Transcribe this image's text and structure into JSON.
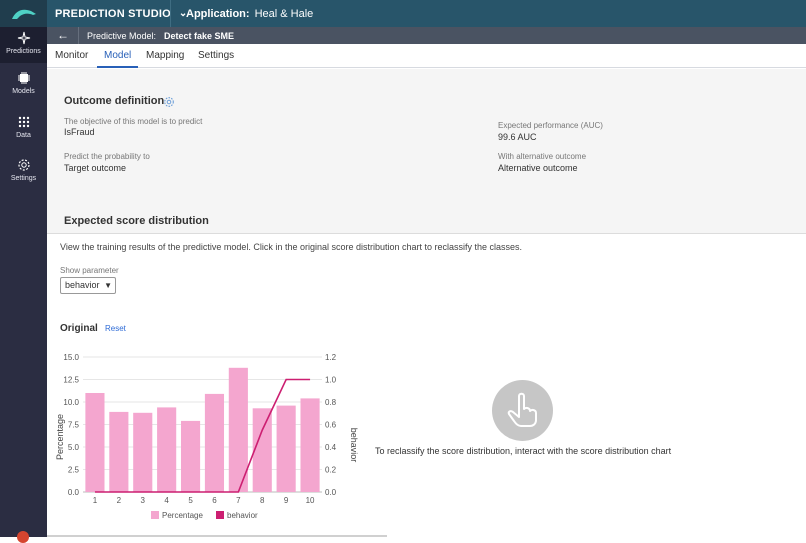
{
  "topbar": {
    "studio_label": "PREDICTION STUDIO",
    "app_label": "Application:",
    "app_name": "Heal & Hale"
  },
  "sidebar": {
    "items": [
      {
        "label": "Predictions"
      },
      {
        "label": "Models"
      },
      {
        "label": "Data"
      },
      {
        "label": "Settings"
      }
    ]
  },
  "subheader": {
    "prefix": "Predictive Model:",
    "model_name": "Detect fake SME"
  },
  "tabs": [
    {
      "label": "Monitor"
    },
    {
      "label": "Model",
      "active": true
    },
    {
      "label": "Mapping"
    },
    {
      "label": "Settings"
    }
  ],
  "outcome": {
    "title": "Outcome definition",
    "objective_label": "The objective of this model is to predict",
    "objective_value": "IsFraud",
    "probability_label": "Predict the probability to",
    "probability_value": "Target outcome",
    "performance_label": "Expected performance (AUC)",
    "performance_value": "99.6 AUC",
    "alternative_label": "With alternative outcome",
    "alternative_value": "Alternative outcome"
  },
  "distribution": {
    "title": "Expected score distribution",
    "description": "View the training results of the predictive model. Click in the original score distribution chart to reclassify the classes.",
    "show_parameter_label": "Show parameter",
    "selected_parameter": "behavior",
    "original_label": "Original",
    "reset_label": "Reset",
    "hint": "To reclassify the score distribution, interact with the score distribution chart"
  },
  "chart_data": {
    "type": "bar",
    "categories": [
      "1",
      "2",
      "3",
      "4",
      "5",
      "6",
      "7",
      "8",
      "9",
      "10"
    ],
    "series": [
      {
        "name": "Percentage",
        "type": "bar",
        "axis": "left",
        "color": "#f4a6cf",
        "values": [
          11.0,
          8.9,
          8.8,
          9.4,
          7.9,
          10.9,
          13.8,
          9.3,
          9.6,
          10.4
        ]
      },
      {
        "name": "behavior",
        "type": "line",
        "axis": "right",
        "color": "#cc1f71",
        "values": [
          0,
          0,
          0,
          0,
          0,
          0,
          0,
          0.55,
          1.0,
          1.0
        ]
      }
    ],
    "ylabel": "Percentage",
    "y2label": "behavior",
    "ylim": [
      0,
      15
    ],
    "y2lim": [
      0,
      1.2
    ],
    "yticks": [
      "0.0",
      "2.5",
      "5.0",
      "7.5",
      "10.0",
      "12.5",
      "15.0"
    ],
    "y2ticks": [
      "0.0",
      "0.2",
      "0.4",
      "0.6",
      "0.8",
      "1.0",
      "1.2"
    ],
    "legend": "bottom"
  }
}
